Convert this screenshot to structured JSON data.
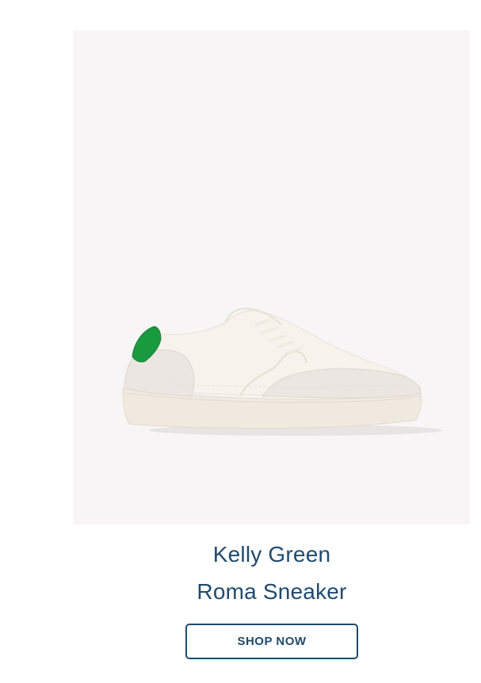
{
  "product": {
    "image": {
      "icon": "white-sneaker-with-green-heel-image"
    },
    "color_name": "Kelly Green",
    "name": "Roma Sneaker",
    "cta_label": "SHOP NOW",
    "colors": {
      "text": "#1f4a6e",
      "card_background": "#f7f5f5",
      "accent_green": "#1a9a3f"
    }
  }
}
